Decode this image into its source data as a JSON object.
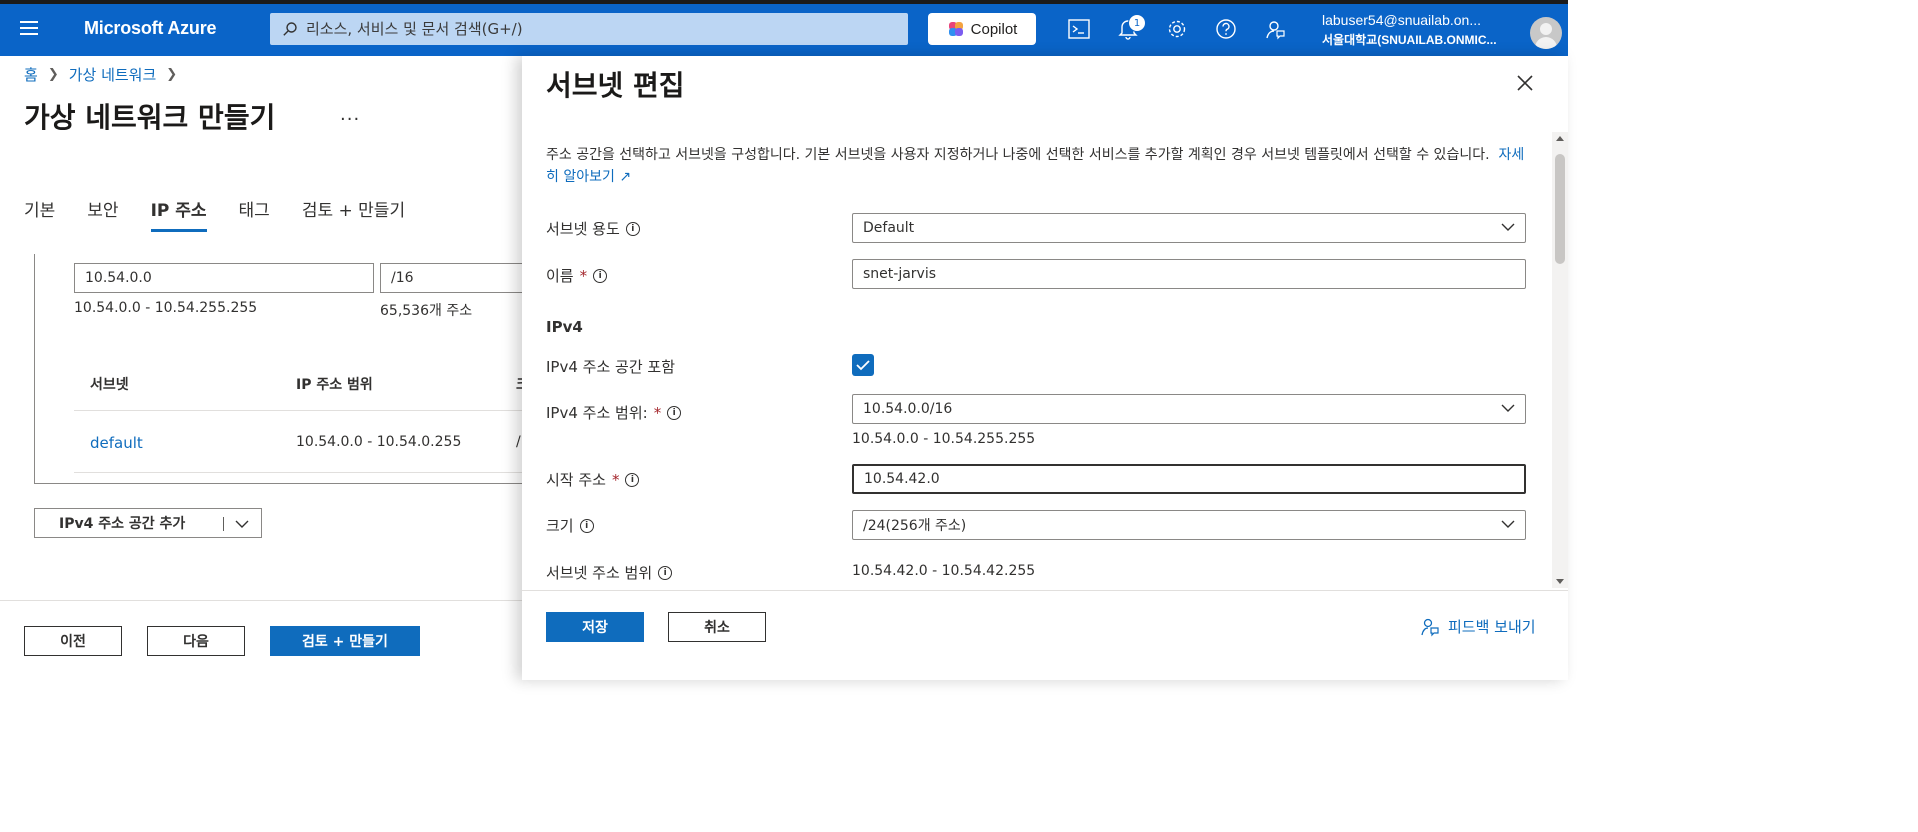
{
  "topbar": {
    "brand": "Microsoft Azure",
    "search_placeholder": "리소스, 서비스 및 문서 검색(G+/)",
    "copilot_label": "Copilot",
    "notification_count": "1",
    "user_email": "labuser54@snuailab.on...",
    "user_org": "서울대학교(SNUAILAB.ONMIC..."
  },
  "breadcrumb": {
    "home": "홈",
    "vnet": "가상 네트워크"
  },
  "page": {
    "title": "가상 네트워크 만들기",
    "more": "...",
    "tabs": [
      "기본",
      "보안",
      "IP 주소",
      "태그",
      "검토 + 만들기"
    ],
    "active_tab": "IP 주소"
  },
  "address_space": {
    "address": "10.54.0.0",
    "prefix": "/16",
    "range": "10.54.0.0 - 10.54.255.255",
    "count": "65,536개 주소",
    "columns": [
      "서브넷",
      "IP 주소 범위",
      "크"
    ],
    "rows": [
      {
        "subnet": "default",
        "range": "10.54.0.0 - 10.54.0.255",
        "size": "/"
      }
    ]
  },
  "add_space_label": "IPv4 주소 공간 추가",
  "footer": {
    "prev": "이전",
    "next": "다음",
    "review": "검토 + 만들기"
  },
  "panel": {
    "title": "서브넷 편집",
    "description": "주소 공간을 선택하고 서브넷을 구성합니다. 기본 서브넷을 사용자 지정하거나 나중에 선택한 서비스를 추가할 계획인 경우 서브넷 템플릿에서 선택할 수 있습니다.",
    "learn_more": "자세히 알아보기",
    "fields": {
      "purpose_label": "서브넷 용도",
      "purpose_value": "Default",
      "name_label": "이름",
      "name_value": "snet-jarvis",
      "section_ipv4": "IPv4",
      "include_label": "IPv4 주소 공간 포함",
      "range_label": "IPv4 주소 범위:",
      "range_value": "10.54.0.0/16",
      "range_hint": "10.54.0.0 - 10.54.255.255",
      "start_label": "시작 주소",
      "start_value": "10.54.42.0",
      "size_label": "크기",
      "size_value": "/24(256개 주소)",
      "subnet_range_label": "서브넷 주소 범위",
      "subnet_range_value": "10.54.42.0 - 10.54.42.255"
    },
    "save": "저장",
    "cancel": "취소",
    "feedback": "피드백 보내기"
  },
  "colors": {
    "topbar": "#0a64c8",
    "accent": "#0f6cbd",
    "required": "#a4262c"
  }
}
